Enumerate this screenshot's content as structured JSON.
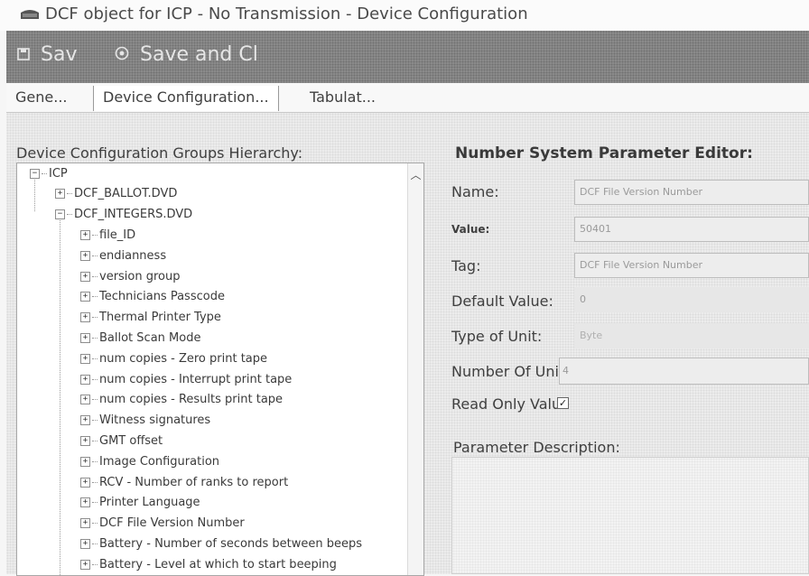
{
  "window": {
    "title": "DCF object for ICP - No Transmission - Device Configuration",
    "icon": "app-window-icon"
  },
  "toolbar": {
    "save_label": "Sav",
    "save_icon": "floppy-disk-icon",
    "save_close_label": "Save and Cl",
    "save_close_icon": "circle-dot-icon"
  },
  "tabs": [
    {
      "label": "Gene..."
    },
    {
      "label": "Device Configuration..."
    },
    {
      "label": "Tabulat..."
    }
  ],
  "hierarchy": {
    "label": "Device Configuration Groups Hierarchy:",
    "root": "ICP",
    "level1": [
      "DCF_BALLOT.DVD",
      "DCF_INTEGERS.DVD"
    ],
    "children": [
      "file_ID",
      "endianness",
      "version group",
      "Technicians Passcode",
      "Thermal Printer Type",
      "Ballot Scan Mode",
      "num copies - Zero print tape",
      "num copies - Interrupt print tape",
      "num copies - Results print tape",
      "Witness signatures",
      "GMT offset",
      "Image Configuration",
      "RCV - Number of ranks to report",
      "Printer Language",
      "DCF File Version Number",
      "Battery - Number of seconds between beeps",
      "Battery - Level at which to start beeping"
    ]
  },
  "editor": {
    "title": "Number System Parameter Editor:",
    "name_label": "Name:",
    "name_value": "DCF File Version Number",
    "value_label": "Value:",
    "value_value": "50401",
    "tag_label": "Tag:",
    "tag_value": "DCF File Version Number",
    "default_label": "Default Value:",
    "default_value": "0",
    "unit_type_label": "Type of Unit:",
    "unit_type_value": "Byte",
    "num_units_label": "Number Of Unit",
    "num_units_value": "4",
    "readonly_label": "Read Only Value",
    "readonly_checked": "✓",
    "description_label": "Parameter Description:"
  }
}
